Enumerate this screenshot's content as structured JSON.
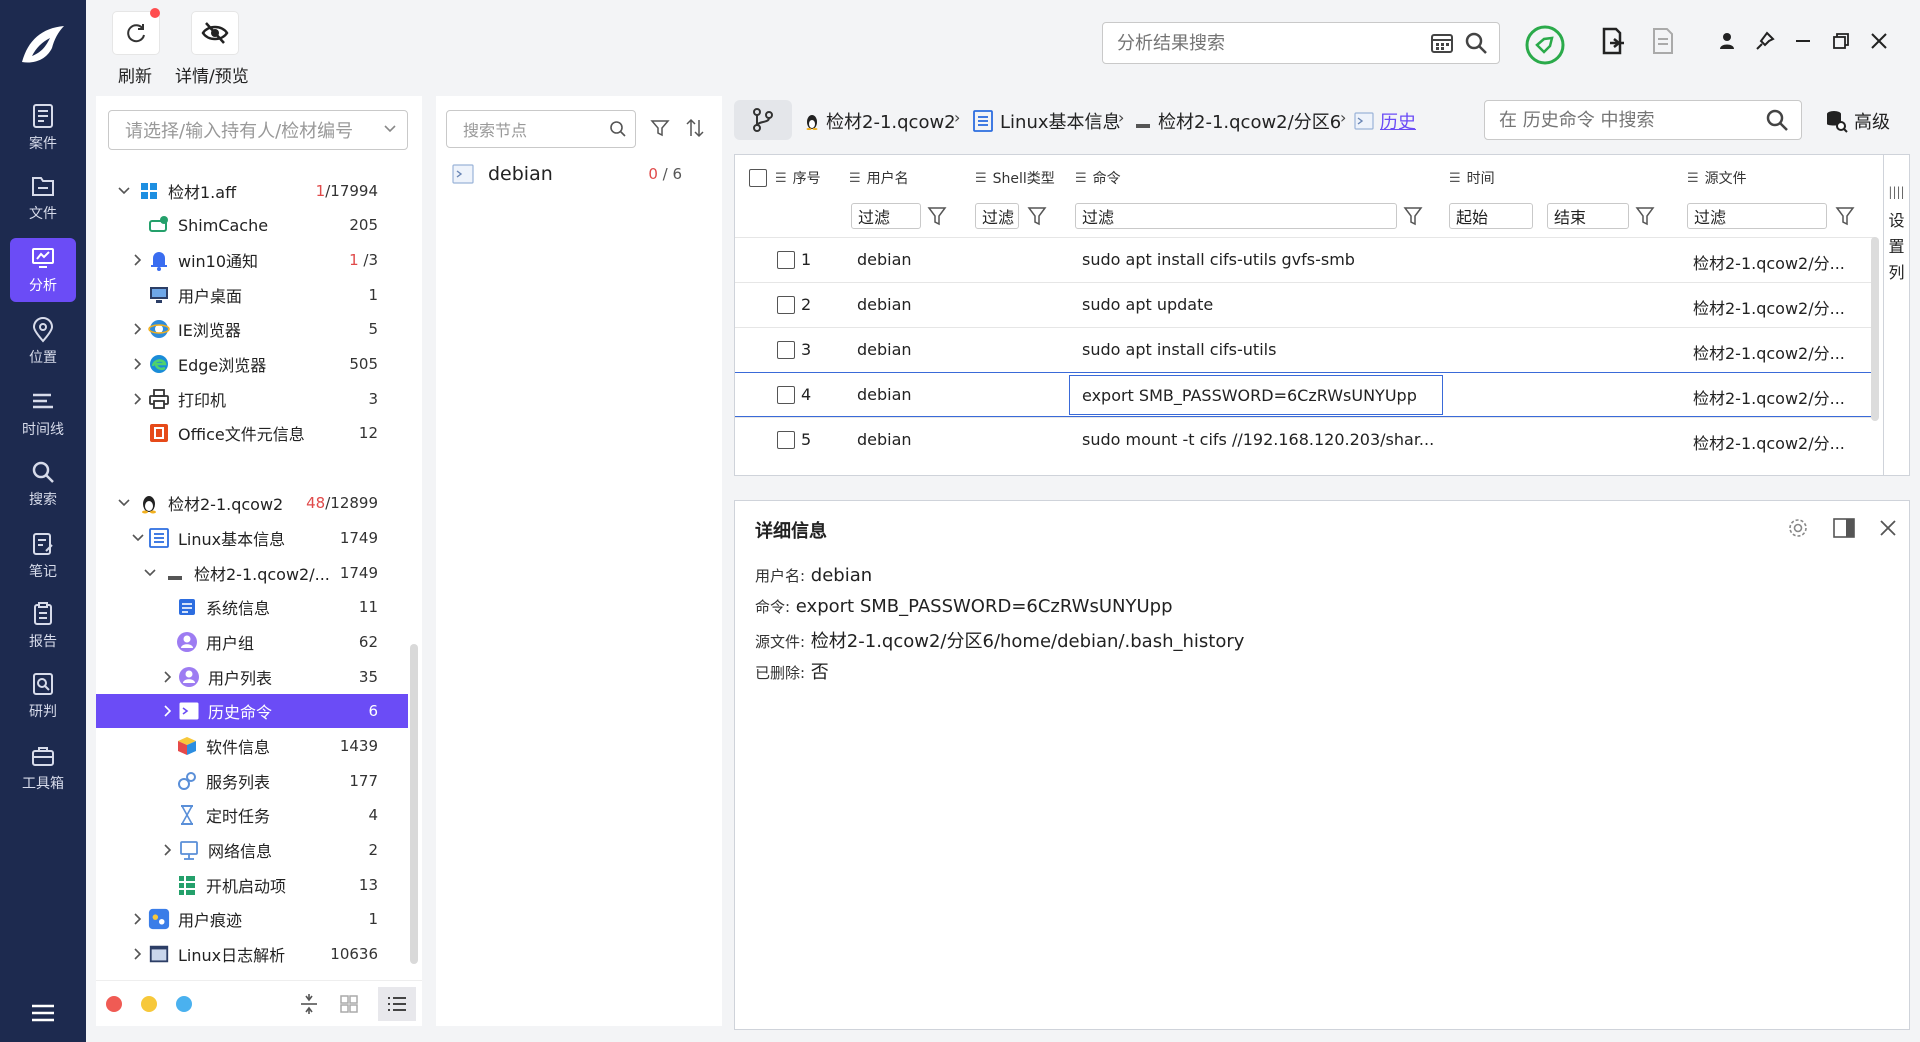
{
  "nav": {
    "items": [
      {
        "label": "案件"
      },
      {
        "label": "文件"
      },
      {
        "label": "分析"
      },
      {
        "label": "位置"
      },
      {
        "label": "时间线"
      },
      {
        "label": "搜索"
      },
      {
        "label": "笔记"
      },
      {
        "label": "报告"
      },
      {
        "label": "研判"
      },
      {
        "label": "工具箱"
      }
    ]
  },
  "toolbar": {
    "refresh_label": "刷新",
    "preview_label": "详情/预览",
    "search_placeholder": "分析结果搜索"
  },
  "tree": {
    "select_placeholder": "请选择/输入持有人/检材编号",
    "nodes": [
      {
        "label": "检材1.aff",
        "count_red": "1",
        "count": "/17994"
      },
      {
        "label": "ShimCache",
        "count": "205"
      },
      {
        "label": "win10通知",
        "count_red": "1",
        "count": " /3"
      },
      {
        "label": "用户桌面",
        "count": "1"
      },
      {
        "label": "IE浏览器",
        "count": "5"
      },
      {
        "label": "Edge浏览器",
        "count": "505"
      },
      {
        "label": "打印机",
        "count": "3"
      },
      {
        "label": "Office文件元信息",
        "count": "12"
      },
      {
        "label": "检材2-1.qcow2",
        "count_red": "48",
        "count": "/12899"
      },
      {
        "label": "Linux基本信息",
        "count": "1749"
      },
      {
        "label": "检材2-1.qcow2/...",
        "count": "1749"
      },
      {
        "label": "系统信息",
        "count": "11"
      },
      {
        "label": "用户组",
        "count": "62"
      },
      {
        "label": "用户列表",
        "count": "35"
      },
      {
        "label": "历史命令",
        "count": "6"
      },
      {
        "label": "软件信息",
        "count": "1439"
      },
      {
        "label": "服务列表",
        "count": "177"
      },
      {
        "label": "定时任务",
        "count": "4"
      },
      {
        "label": "网络信息",
        "count": "2"
      },
      {
        "label": "开机启动项",
        "count": "13"
      },
      {
        "label": "用户痕迹",
        "count": "1"
      },
      {
        "label": "Linux日志解析",
        "count": "10636"
      }
    ]
  },
  "nodes_panel": {
    "search_placeholder": "搜索节点",
    "item_label": "debian",
    "item_count_red": "0",
    "item_count": " / 6"
  },
  "breadcrumb": {
    "items": [
      "检材2-1.qcow2",
      "Linux基本信息",
      "检材2-1.qcow2/分区6",
      "历史"
    ],
    "search_placeholder": "在 历史命令 中搜索",
    "advanced_label": "高级"
  },
  "table": {
    "columns": [
      "序号",
      "用户名",
      "Shell类型",
      "命令",
      "时间",
      "源文件"
    ],
    "filter_label": "过滤",
    "filter_start": "起始",
    "filter_end": "结束",
    "side_tab": [
      "设",
      "置",
      "列"
    ],
    "rows": [
      {
        "idx": "1",
        "user": "debian",
        "cmd": "sudo apt install cifs-utils gvfs-smb",
        "src": "检材2-1.qcow2/分..."
      },
      {
        "idx": "2",
        "user": "debian",
        "cmd": "sudo apt update",
        "src": "检材2-1.qcow2/分..."
      },
      {
        "idx": "3",
        "user": "debian",
        "cmd": "sudo apt install cifs-utils",
        "src": "检材2-1.qcow2/分..."
      },
      {
        "idx": "4",
        "user": "debian",
        "cmd": "export SMB_PASSWORD=6CzRWsUNYUpp",
        "src": "检材2-1.qcow2/分..."
      },
      {
        "idx": "5",
        "user": "debian",
        "cmd": "sudo mount -t cifs //192.168.120.203/shar...",
        "src": "检材2-1.qcow2/分..."
      }
    ]
  },
  "detail": {
    "title": "详细信息",
    "fields": [
      {
        "key": "用户名:",
        "value": "debian"
      },
      {
        "key": "命令:",
        "value": "export SMB_PASSWORD=6CzRWsUNYUpp"
      },
      {
        "key": "源文件:",
        "value": "检材2-1.qcow2/分区6/home/debian/.bash_history"
      },
      {
        "key": "已删除:",
        "value": "否"
      }
    ]
  },
  "colors": {
    "nav_bg": "#1d2a4f",
    "accent": "#6b4cf6",
    "selection_border": "#3a6ad8",
    "count_red": "#e04a4a",
    "dot_red": "#f05b54",
    "dot_yellow": "#f7c83a",
    "dot_blue": "#4ab1ef"
  }
}
